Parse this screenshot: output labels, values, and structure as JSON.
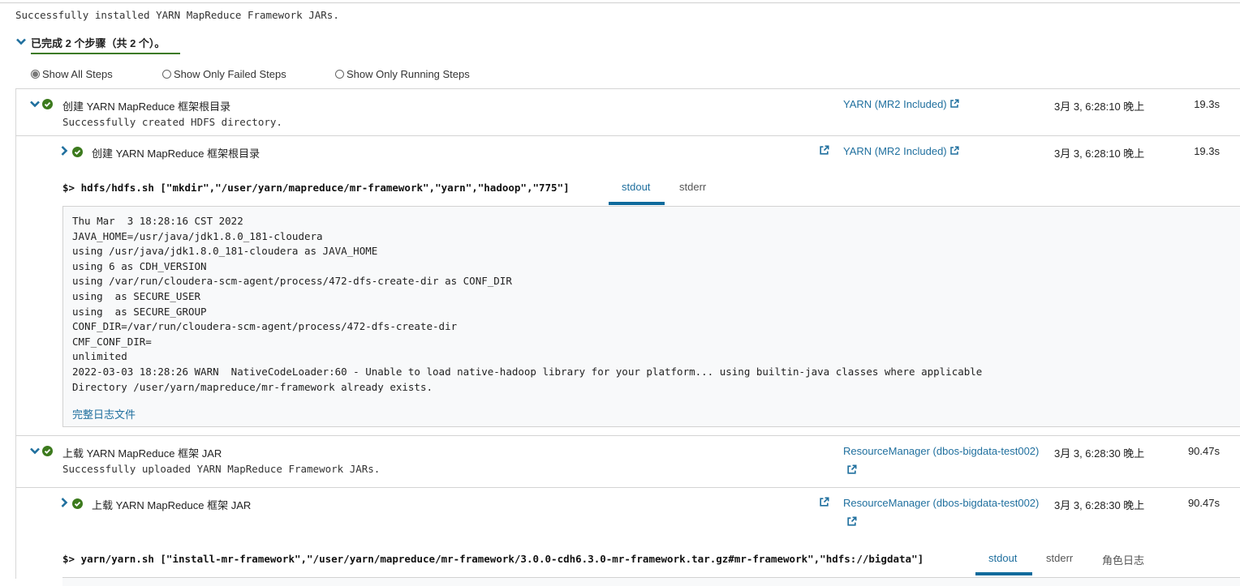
{
  "summary_message": "Successfully installed YARN MapReduce Framework JARs.",
  "steps_header": {
    "title": "已完成 2 个步骤（共 2 个）。",
    "accent_color": "#3c7a1d"
  },
  "filters": {
    "options": [
      {
        "label": "Show All Steps",
        "selected": true
      },
      {
        "label": "Show Only Failed Steps",
        "selected": false
      },
      {
        "label": "Show Only Running Steps",
        "selected": false
      }
    ]
  },
  "steps": [
    {
      "title": "创建 YARN MapReduce 框架根目录",
      "message": "Successfully created HDFS directory.",
      "context_link": "YARN (MR2 Included)",
      "time": "3月 3, 6:28:10 晚上",
      "duration": "19.3s",
      "status": "success",
      "substep": {
        "title": "创建 YARN MapReduce 框架根目录",
        "context_link": "YARN (MR2 Included)",
        "time": "3月 3, 6:28:10 晚上",
        "duration": "19.3s",
        "command": "$> hdfs/hdfs.sh [\"mkdir\",\"/user/yarn/mapreduce/mr-framework\",\"yarn\",\"hadoop\",\"775\"]",
        "tabs": [
          "stdout",
          "stderr"
        ],
        "active_tab": "stdout",
        "log_lines": [
          "Thu Mar  3 18:28:16 CST 2022",
          "JAVA_HOME=/usr/java/jdk1.8.0_181-cloudera",
          "using /usr/java/jdk1.8.0_181-cloudera as JAVA_HOME",
          "using 6 as CDH_VERSION",
          "using /var/run/cloudera-scm-agent/process/472-dfs-create-dir as CONF_DIR",
          "using  as SECURE_USER",
          "using  as SECURE_GROUP",
          "CONF_DIR=/var/run/cloudera-scm-agent/process/472-dfs-create-dir",
          "CMF_CONF_DIR=",
          "unlimited",
          "2022-03-03 18:28:26 WARN  NativeCodeLoader:60 - Unable to load native-hadoop library for your platform... using builtin-java classes where applicable",
          "Directory /user/yarn/mapreduce/mr-framework already exists."
        ],
        "full_log_link": "完整日志文件"
      }
    },
    {
      "title": "上载 YARN MapReduce 框架 JAR",
      "message": "Successfully uploaded YARN MapReduce Framework JARs.",
      "context_link": "ResourceManager (dbos-bigdata-test002)",
      "time": "3月 3, 6:28:30 晚上",
      "duration": "90.47s",
      "status": "success",
      "substep": {
        "title": "上载 YARN MapReduce 框架 JAR",
        "context_link": "ResourceManager (dbos-bigdata-test002)",
        "time": "3月 3, 6:28:30 晚上",
        "duration": "90.47s",
        "command": "$> yarn/yarn.sh [\"install-mr-framework\",\"/user/yarn/mapreduce/mr-framework/3.0.0-cdh6.3.0-mr-framework.tar.gz#mr-framework\",\"hdfs://bigdata\"]",
        "tabs": [
          "stdout",
          "stderr",
          "角色日志"
        ],
        "active_tab": "stdout"
      }
    }
  ],
  "colors": {
    "link": "#1f6f9e",
    "success": "#3c7a1d",
    "tab_active": "#0e6a9c"
  }
}
